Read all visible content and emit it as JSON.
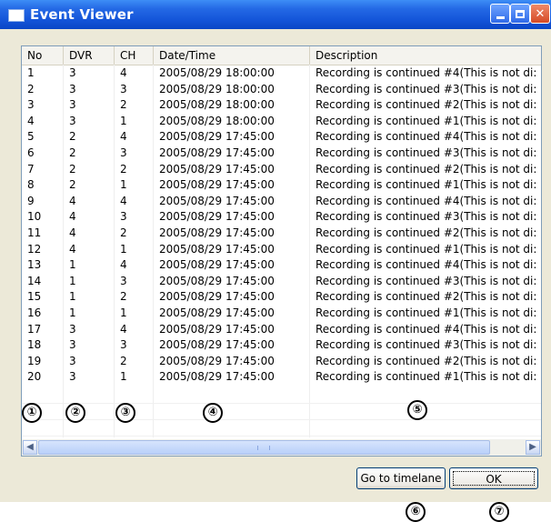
{
  "window": {
    "title": "Event Viewer"
  },
  "columns": [
    "No",
    "DVR",
    "CH",
    "Date/Time",
    "Description"
  ],
  "rows": [
    [
      "1",
      "3",
      "4",
      "2005/08/29 18:00:00",
      "Recording is continued #4(This is not di:"
    ],
    [
      "2",
      "3",
      "3",
      "2005/08/29 18:00:00",
      "Recording is continued #3(This is not di:"
    ],
    [
      "3",
      "3",
      "2",
      "2005/08/29 18:00:00",
      "Recording is continued #2(This is not di:"
    ],
    [
      "4",
      "3",
      "1",
      "2005/08/29 18:00:00",
      "Recording is continued #1(This is not di:"
    ],
    [
      "5",
      "2",
      "4",
      "2005/08/29 17:45:00",
      "Recording is continued #4(This is not di:"
    ],
    [
      "6",
      "2",
      "3",
      "2005/08/29 17:45:00",
      "Recording is continued #3(This is not di:"
    ],
    [
      "7",
      "2",
      "2",
      "2005/08/29 17:45:00",
      "Recording is continued #2(This is not di:"
    ],
    [
      "8",
      "2",
      "1",
      "2005/08/29 17:45:00",
      "Recording is continued #1(This is not di:"
    ],
    [
      "9",
      "4",
      "4",
      "2005/08/29 17:45:00",
      "Recording is continued #4(This is not di:"
    ],
    [
      "10",
      "4",
      "3",
      "2005/08/29 17:45:00",
      "Recording is continued #3(This is not di:"
    ],
    [
      "11",
      "4",
      "2",
      "2005/08/29 17:45:00",
      "Recording is continued #2(This is not di:"
    ],
    [
      "12",
      "4",
      "1",
      "2005/08/29 17:45:00",
      "Recording is continued #1(This is not di:"
    ],
    [
      "13",
      "1",
      "4",
      "2005/08/29 17:45:00",
      "Recording is continued #4(This is not di:"
    ],
    [
      "14",
      "1",
      "3",
      "2005/08/29 17:45:00",
      "Recording is continued #3(This is not di:"
    ],
    [
      "15",
      "1",
      "2",
      "2005/08/29 17:45:00",
      "Recording is continued #2(This is not di:"
    ],
    [
      "16",
      "1",
      "1",
      "2005/08/29 17:45:00",
      "Recording is continued #1(This is not di:"
    ],
    [
      "17",
      "3",
      "4",
      "2005/08/29 17:45:00",
      "Recording is continued #4(This is not di:"
    ],
    [
      "18",
      "3",
      "3",
      "2005/08/29 17:45:00",
      "Recording is continued #3(This is not di:"
    ],
    [
      "19",
      "3",
      "2",
      "2005/08/29 17:45:00",
      "Recording is continued #2(This is not di:"
    ],
    [
      "20",
      "3",
      "1",
      "2005/08/29 17:45:00",
      "Recording is continued #1(This is not di:"
    ]
  ],
  "buttons": {
    "timelane": "Go to timelane",
    "ok": "OK"
  },
  "callouts": [
    "①",
    "②",
    "③",
    "④",
    "⑤",
    "⑥",
    "⑦"
  ],
  "icons": [
    "window-icon",
    "minimize-icon",
    "maximize-icon",
    "close-icon",
    "scroll-left-icon",
    "scroll-right-icon"
  ]
}
